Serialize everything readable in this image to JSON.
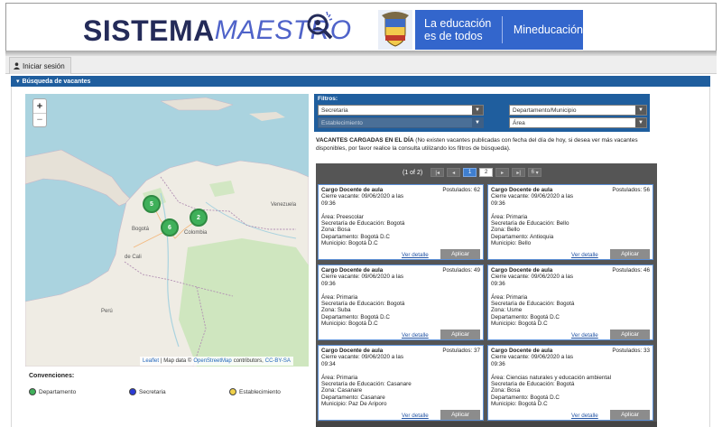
{
  "header": {
    "brand_part1": "SISTEMA",
    "brand_part2": "MAESTRO",
    "edu_line1": "La educación",
    "edu_line2": "es de todos",
    "ministry": "Mineducación"
  },
  "login_tab": {
    "label": "Iniciar sesión",
    "icon": "user-icon"
  },
  "section": {
    "title": "Búsqueda de vacantes",
    "icon": "caret-down-icon"
  },
  "map": {
    "zoom_in": "+",
    "zoom_out": "−",
    "labels": {
      "venezuela": "Venezuela",
      "cali": "de Cali",
      "bogota": "Bogotá",
      "colombia": "Colombia",
      "peru": "Perú"
    },
    "clusters": [
      {
        "count": "5",
        "color": "#3fb05a"
      },
      {
        "count": "6",
        "color": "#3fb05a"
      },
      {
        "count": "2",
        "color": "#3fb05a"
      }
    ],
    "attribution": {
      "leaflet": "Leaflet",
      "sep": "| Map data ©",
      "osm": "OpenStreetMap",
      "contrib": "contributors,",
      "license": "CC-BY-SA"
    }
  },
  "conventions": {
    "title": "Convenciones:",
    "items": [
      {
        "label": "Departamento",
        "color": "#3fb05a"
      },
      {
        "label": "Secretaria",
        "color": "#2b3bd6"
      },
      {
        "label": "Establecimiento",
        "color": "#f0d14a"
      }
    ]
  },
  "filters": {
    "title": "Filtros:",
    "secretaria": "Secretaria",
    "departamento": "Departamento/Municipio",
    "establecimiento": "Establecimiento",
    "area": "Área"
  },
  "vacancies_note": {
    "bold": "VACANTES CARGADAS EN EL DÍA",
    "text": " (No existen vacantes publicadas con fecha del día de hoy, si desea ver más vacantes disponibles, por favor realice la consulta utilizando los filtros de búsqueda)."
  },
  "pager": {
    "info": "(1 of 2)",
    "first": "|◂",
    "prev": "◂",
    "pages": [
      "1",
      "2"
    ],
    "current": "1",
    "next": "▸",
    "last": "▸|",
    "per_page": "6"
  },
  "cards": [
    {
      "title": "Cargo Docente de aula",
      "postulados": "Postulados: 62",
      "cierre": "Cierre vacante: 09/06/2020 a las",
      "hora": "09:36",
      "area": "Área: Preescolar",
      "secretaria": "Secretaría de Educación: Bogotá",
      "zona": "Zona: Bosa",
      "departamento": "Departamento: Bogotá D.C",
      "municipio": "Municipio: Bogotá D.C",
      "link": "Ver detalle",
      "button": "Aplicar"
    },
    {
      "title": "Cargo Docente de aula",
      "postulados": "Postulados: 56",
      "cierre": "Cierre vacante: 09/06/2020 a las",
      "hora": "09:36",
      "area": "Área: Primaria",
      "secretaria": "Secretaría de Educación: Bello",
      "zona": "Zona: Bello",
      "departamento": "Departamento: Antioquia",
      "municipio": "Municipio: Bello",
      "link": "Ver detalle",
      "button": "Aplicar"
    },
    {
      "title": "Cargo Docente de aula",
      "postulados": "Postulados: 49",
      "cierre": "Cierre vacante: 09/06/2020 a las",
      "hora": "09:36",
      "area": "Área: Primaria",
      "secretaria": "Secretaría de Educación: Bogotá",
      "zona": "Zona: Suba",
      "departamento": "Departamento: Bogotá D.C",
      "municipio": "Municipio: Bogotá D.C",
      "link": "Ver detalle",
      "button": "Aplicar"
    },
    {
      "title": "Cargo Docente de aula",
      "postulados": "Postulados: 46",
      "cierre": "Cierre vacante: 09/06/2020 a las",
      "hora": "09:36",
      "area": "Área: Primaria",
      "secretaria": "Secretaría de Educación: Bogotá",
      "zona": "Zona: Usme",
      "departamento": "Departamento: Bogotá D.C",
      "municipio": "Municipio: Bogotá D.C",
      "link": "Ver detalle",
      "button": "Aplicar"
    },
    {
      "title": "Cargo Docente de aula",
      "postulados": "Postulados: 37",
      "cierre": "Cierre vacante: 09/06/2020 a las",
      "hora": "09:34",
      "area": "Área: Primaria",
      "secretaria": "Secretaría de Educación: Casanare",
      "zona": "Zona: Casanare",
      "departamento": "Departamento: Casanare",
      "municipio": "Municipio: Paz De Ariporo",
      "link": "Ver detalle",
      "button": "Aplicar"
    },
    {
      "title": "Cargo Docente de aula",
      "postulados": "Postulados: 33",
      "cierre": "Cierre vacante: 09/06/2020 a las",
      "hora": "09:36",
      "area": "Área: Ciencias naturales y educación ambiental",
      "secretaria": "Secretaría de Educación: Bogotá",
      "zona": "Zona: Bosa",
      "departamento": "Departamento: Bogotá D.C",
      "municipio": "Municipio: Bogotá D.C",
      "link": "Ver detalle",
      "button": "Aplicar"
    }
  ]
}
